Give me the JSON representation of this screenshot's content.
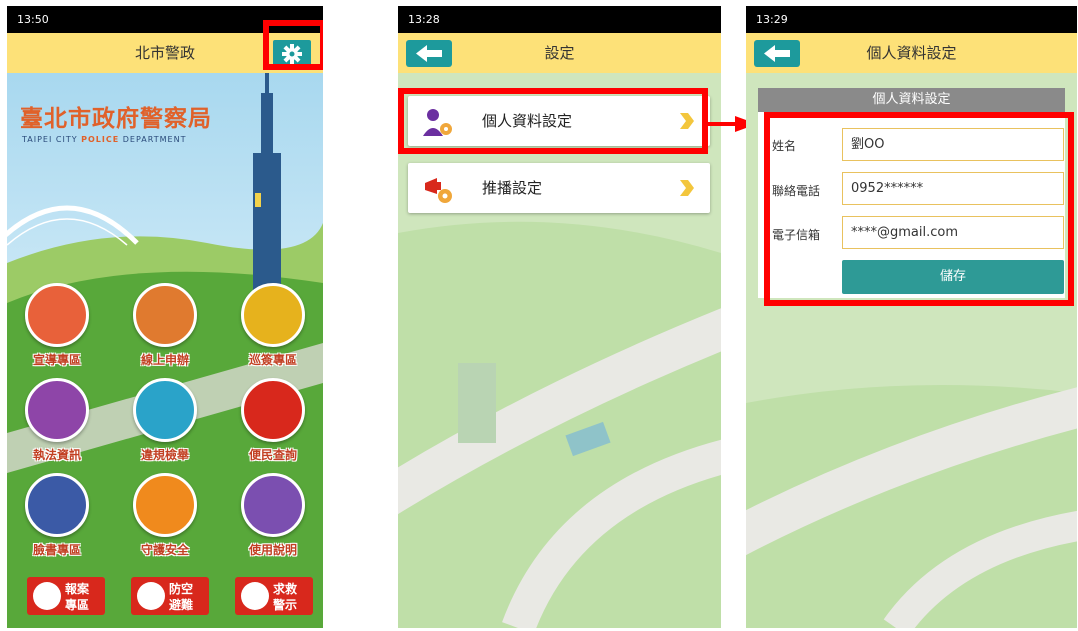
{
  "screen1": {
    "status_time": "13:50",
    "app_title": "北市警政",
    "logo_title": "臺北市政府警察局",
    "logo_sub": [
      "TAIPEI CITY ",
      "POLICE",
      " DEPARTMENT"
    ],
    "tiles": [
      {
        "label": "宣導專區",
        "icon": "megaphone-icon",
        "color": "#e8613a"
      },
      {
        "label": "線上申辦",
        "icon": "officer-icon",
        "color": "#e07a2f"
      },
      {
        "label": "巡簽專區",
        "icon": "lock-icon",
        "color": "#e6b21d"
      },
      {
        "label": "執法資訊",
        "icon": "book-hand-icon",
        "color": "#8e45a8"
      },
      {
        "label": "違規檢舉",
        "icon": "car-camera-icon",
        "color": "#2aa3c9"
      },
      {
        "label": "便民查詢",
        "icon": "person-search-icon",
        "color": "#d8281c"
      },
      {
        "label": "臉書專區",
        "icon": "facebook-icon",
        "color": "#3b5aa6"
      },
      {
        "label": "守護安全",
        "icon": "heart-hands-icon",
        "color": "#f08a1d"
      },
      {
        "label": "使用說明",
        "icon": "police-cap-icon",
        "color": "#7b4fb0"
      }
    ],
    "emergency": [
      {
        "line1": "報案",
        "line2": "專區",
        "icon": "siren-icon"
      },
      {
        "line1": "防空",
        "line2": "避難",
        "icon": "evacuate-icon"
      },
      {
        "line1": "求救",
        "line2": "警示",
        "icon": "sos-icon"
      }
    ]
  },
  "screen2": {
    "status_time": "13:28",
    "app_title": "設定",
    "menu": [
      {
        "label": "個人資料設定",
        "icon": "person-gear-icon"
      },
      {
        "label": "推播設定",
        "icon": "megaphone-gear-icon"
      }
    ]
  },
  "screen3": {
    "status_time": "13:29",
    "app_title": "個人資料設定",
    "section_title": "個人資料設定",
    "fields": [
      {
        "label": "姓名",
        "value": "劉OO"
      },
      {
        "label": "聯絡電話",
        "value": "0952******"
      },
      {
        "label": "電子信箱",
        "value": "****@gmail.com"
      }
    ],
    "save_label": "儲存"
  },
  "colors": {
    "appbar": "#fde178",
    "teal": "#1d9a9c",
    "highlight": "#ff0000"
  }
}
